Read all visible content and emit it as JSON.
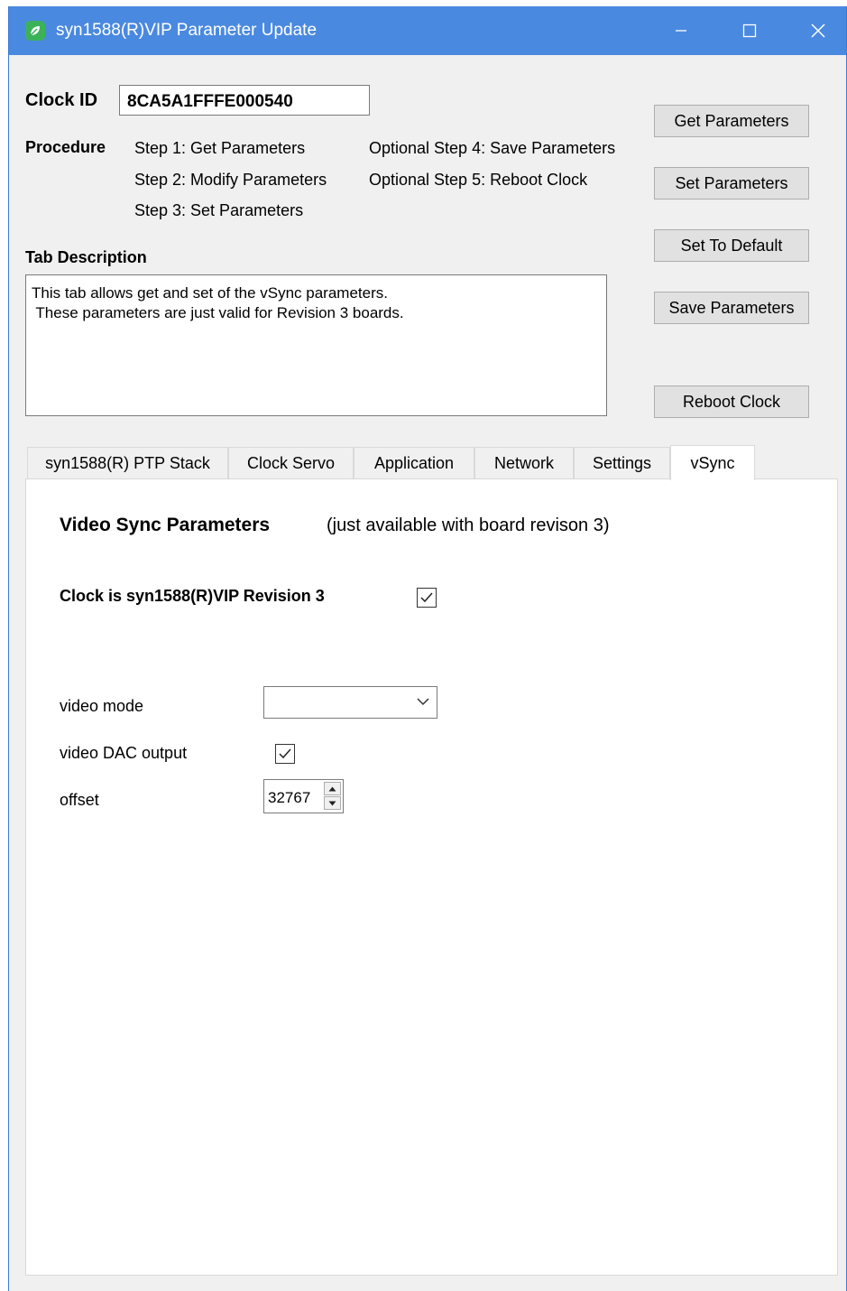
{
  "window": {
    "title": "syn1588(R)VIP Parameter Update",
    "title_bar_color": "#4a89e0",
    "icon": "app-leaf-icon"
  },
  "clock": {
    "label": "Clock ID",
    "value": "8CA5A1FFFE000540"
  },
  "procedure": {
    "label": "Procedure",
    "steps": [
      "Step 1: Get Parameters",
      "Step 2: Modify Parameters",
      "Step 3: Set Parameters",
      "Optional Step 4: Save Parameters",
      "Optional Step 5: Reboot Clock"
    ]
  },
  "tab_description": {
    "label": "Tab Description",
    "text": "This tab allows get and set of the vSync parameters.\n These parameters are just valid for Revision 3 boards."
  },
  "buttons": {
    "get": "Get Parameters",
    "set": "Set Parameters",
    "default": "Set To Default",
    "save": "Save Parameters",
    "reboot": "Reboot Clock"
  },
  "tabs": [
    "syn1588(R) PTP Stack",
    "Clock Servo",
    "Application",
    "Network",
    "Settings",
    "vSync"
  ],
  "active_tab": "vSync",
  "vsync": {
    "heading": "Video Sync Parameters",
    "heading_note": "(just available with board revison 3)",
    "revision_label": "Clock is syn1588(R)VIP Revision 3",
    "revision_checked": true,
    "video_mode_label": "video mode",
    "video_mode_value": "",
    "dac_label": "video DAC output",
    "dac_checked": true,
    "offset_label": "offset",
    "offset_value": "32767"
  }
}
